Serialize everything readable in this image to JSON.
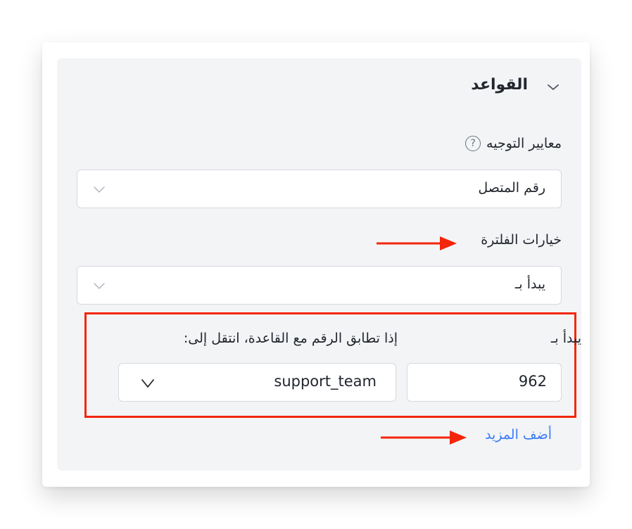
{
  "rules_section": {
    "title": "القواعد",
    "collapse_icon": "chevron-down-icon"
  },
  "routing_criteria": {
    "label": "معايير التوجيه",
    "help_icon": "question-circle-icon",
    "help_glyph": "?",
    "selected": "رقم المتصل"
  },
  "filter_options": {
    "label": "خيارات الفلترة",
    "selected": "يبدأ بـ"
  },
  "rule_row": {
    "starts_with_label": "يبدأ بـ",
    "goto_label": "إذا تطابق الرقم مع القاعدة، انتقل إلى:",
    "prefix_value": "962",
    "target_value": "support_team"
  },
  "add_more_label": "أضف المزيد",
  "colors": {
    "annotation_red": "#f3260b",
    "link_blue": "#3b7bf6",
    "panel_bg": "#f3f4f6"
  }
}
